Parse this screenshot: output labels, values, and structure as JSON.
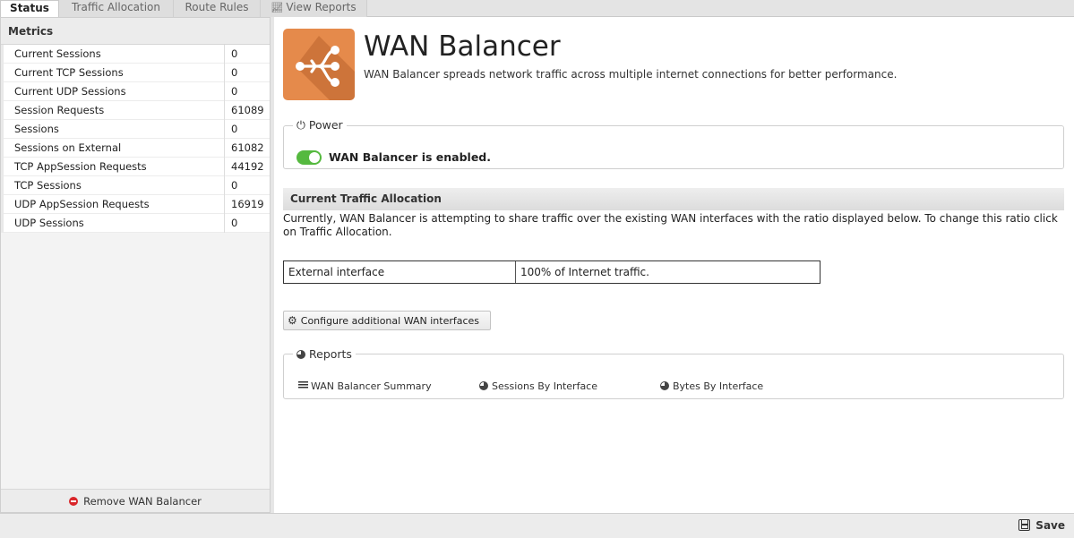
{
  "tabs": [
    {
      "label": "Status",
      "active": true
    },
    {
      "label": "Traffic Allocation",
      "active": false
    },
    {
      "label": "Route Rules",
      "active": false
    },
    {
      "label": "View Reports",
      "active": false,
      "icon": "chart-icon"
    }
  ],
  "metrics": {
    "title": "Metrics",
    "rows": [
      {
        "name": "Current Sessions",
        "value": "0"
      },
      {
        "name": "Current TCP Sessions",
        "value": "0"
      },
      {
        "name": "Current UDP Sessions",
        "value": "0"
      },
      {
        "name": "Session Requests",
        "value": "61089"
      },
      {
        "name": "Sessions",
        "value": "0"
      },
      {
        "name": "Sessions on External",
        "value": "61082"
      },
      {
        "name": "TCP AppSession Requests",
        "value": "44192"
      },
      {
        "name": "TCP Sessions",
        "value": "0"
      },
      {
        "name": "UDP AppSession Requests",
        "value": "16919"
      },
      {
        "name": "UDP Sessions",
        "value": "0"
      }
    ],
    "remove_label": "Remove WAN Balancer"
  },
  "app": {
    "title": "WAN Balancer",
    "description": "WAN Balancer spreads network traffic across multiple internet connections for better performance.",
    "icon": "wan-balancer-icon",
    "icon_color": "#e58a4b"
  },
  "power": {
    "legend": "Power",
    "status_text": "WAN Balancer is enabled.",
    "enabled": true,
    "toggle_color": "#55b93f"
  },
  "traffic": {
    "heading": "Current Traffic Allocation",
    "description": "Currently, WAN Balancer is attempting to share traffic over the existing WAN interfaces with the ratio displayed below. To change this ratio click on Traffic Allocation.",
    "rows": [
      {
        "interface": "External interface",
        "share": "100% of Internet traffic."
      }
    ],
    "configure_button": "Configure additional WAN interfaces"
  },
  "reports": {
    "legend": "Reports",
    "links": [
      {
        "label": "WAN Balancer Summary",
        "icon": "list-icon"
      },
      {
        "label": "Sessions By Interface",
        "icon": "pie-chart-icon"
      },
      {
        "label": "Bytes By Interface",
        "icon": "pie-chart-icon"
      }
    ]
  },
  "footer": {
    "save_label": "Save"
  }
}
